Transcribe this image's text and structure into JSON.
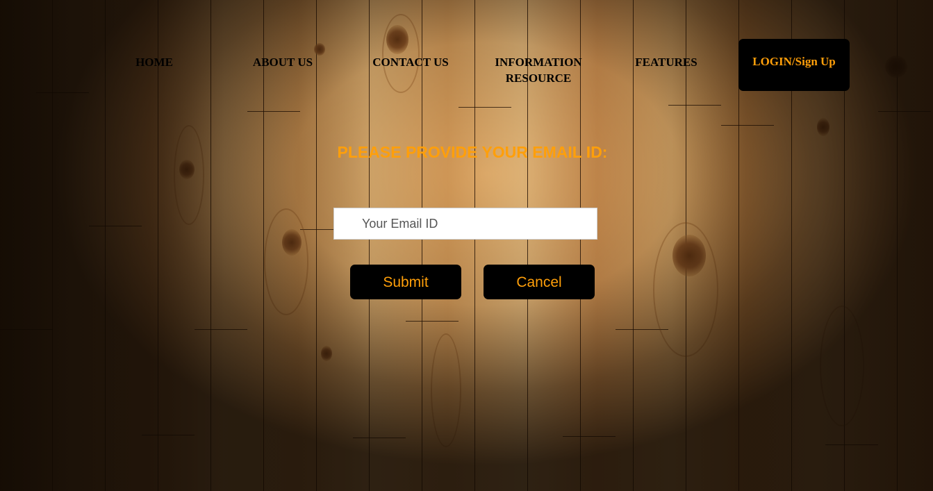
{
  "nav": {
    "home": "HOME",
    "about": "ABOUT US",
    "contact": "CONTACT US",
    "information_resource": "INFORMATION RESOURCE",
    "features": "FEATURES",
    "login": "LOGIN/Sign Up"
  },
  "form": {
    "heading": "PLEASE PROVIDE YOUR EMAIL ID:",
    "email_placeholder": "Your Email ID",
    "email_value": "",
    "submit_label": "Submit",
    "cancel_label": "Cancel"
  },
  "colors": {
    "accent": "#ff9f0a",
    "button_bg": "#000000",
    "nav_text": "#000000"
  }
}
